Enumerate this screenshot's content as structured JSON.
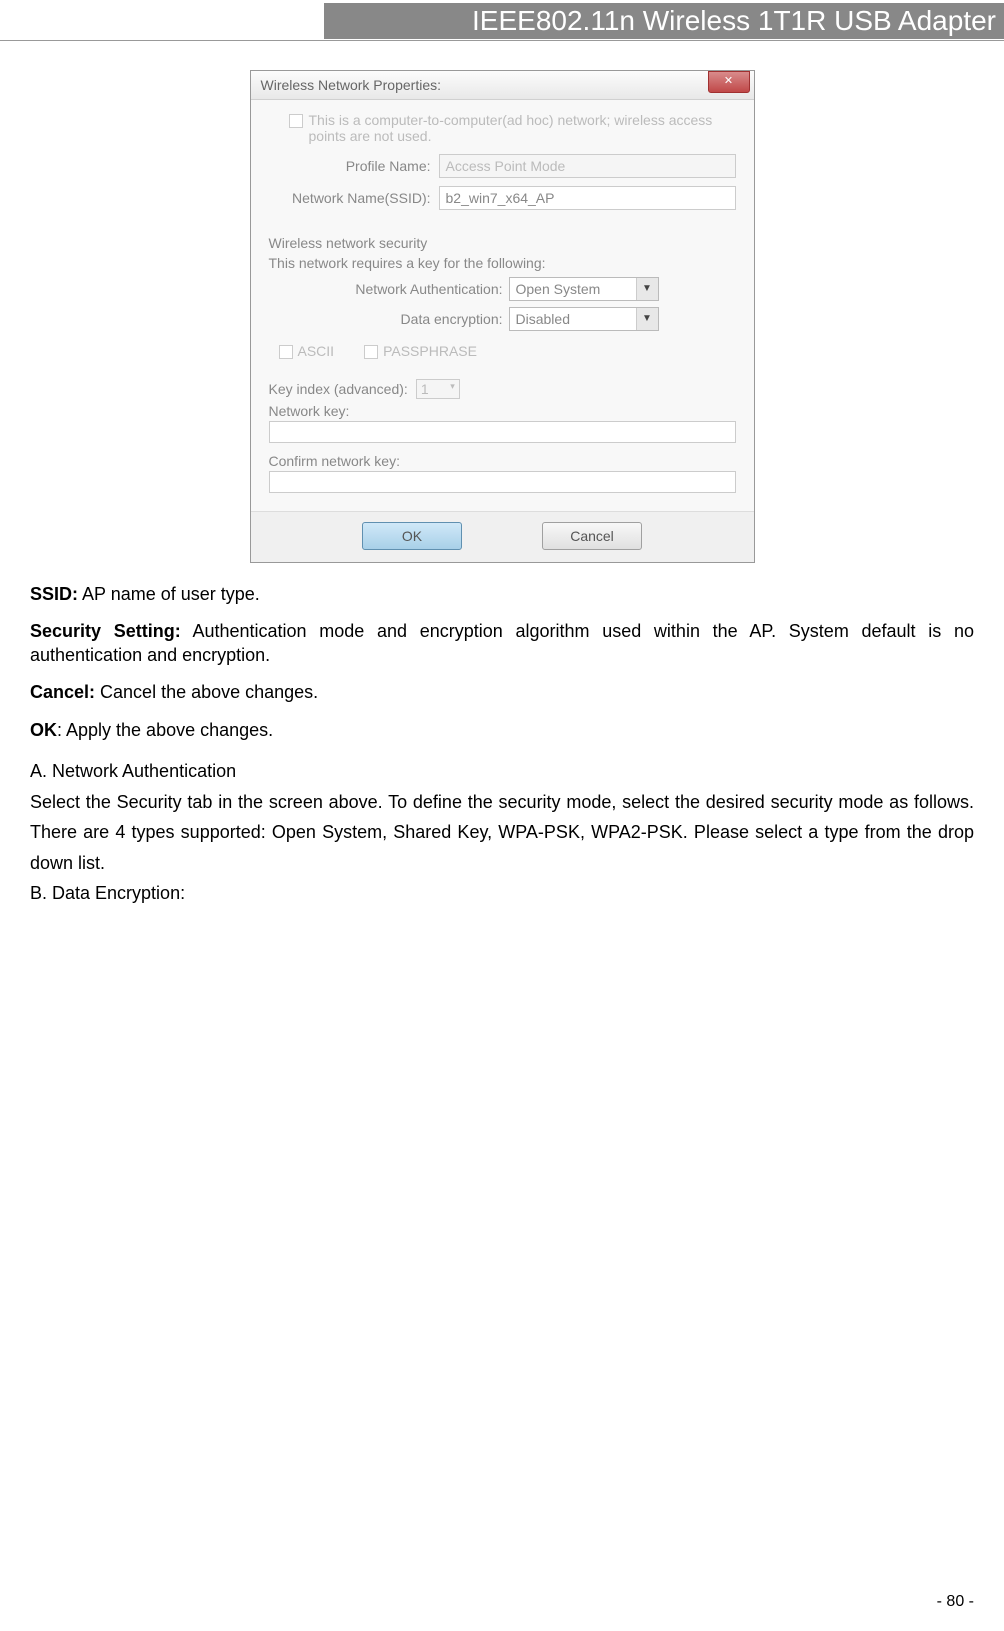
{
  "header": {
    "title": "IEEE802.11n Wireless 1T1R USB Adapter"
  },
  "dialog": {
    "title": "Wireless Network Properties:",
    "adhoc_text": "This is a computer-to-computer(ad hoc) network; wireless access points are not used.",
    "profile_label": "Profile Name:",
    "profile_value": "Access Point Mode",
    "ssid_label": "Network Name(SSID):",
    "ssid_value": "b2_win7_x64_AP",
    "security_header": "Wireless network security",
    "security_subtext": "This network requires a key for the following:",
    "auth_label": "Network Authentication:",
    "auth_value": "Open System",
    "encryption_label": "Data encryption:",
    "encryption_value": "Disabled",
    "ascii_label": "ASCII",
    "passphrase_label": "PASSPHRASE",
    "key_index_label": "Key index (advanced):",
    "key_index_value": "1",
    "network_key_label": "Network key:",
    "confirm_key_label": "Confirm network key:",
    "ok_label": "OK",
    "cancel_label": "Cancel"
  },
  "doc": {
    "ssid_bold": "SSID:",
    "ssid_text": " AP name of user type.",
    "security_bold": "Security Setting:",
    "security_text": " Authentication mode and encryption algorithm used within the AP. System default is no authentication and encryption.",
    "cancel_bold": "Cancel:",
    "cancel_text": " Cancel the above changes.",
    "ok_bold": "OK",
    "ok_text": ": Apply the above changes.",
    "section_a": "A. Network Authentication",
    "section_a_text": "Select the Security tab in the screen above. To define the security mode, select the desired security mode as follows. There are 4 types supported: Open System, Shared Key, WPA-PSK, WPA2-PSK. Please select a type from the drop down list.",
    "section_b": "B. Data Encryption:"
  },
  "page_number": "- 80 -"
}
